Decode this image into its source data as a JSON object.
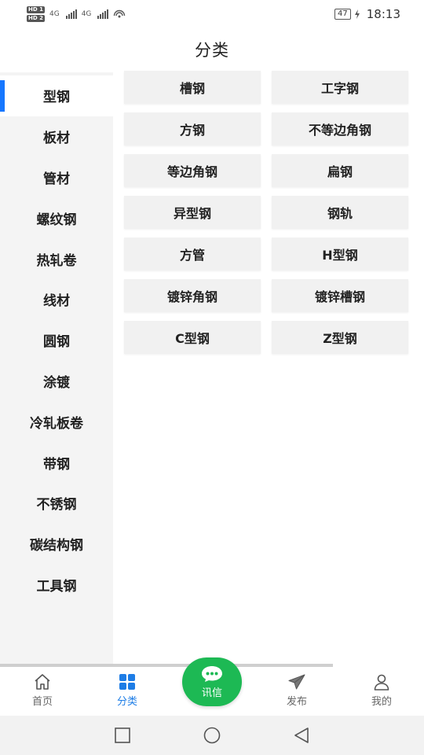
{
  "status": {
    "sim1": "HD 1",
    "sim2": "HD 2",
    "net1": "4G",
    "net2": "4G",
    "battery": "47",
    "time": "18:13"
  },
  "header": {
    "title": "分类"
  },
  "sidebar": {
    "active_index": 0,
    "items": [
      {
        "label": "型钢"
      },
      {
        "label": "板材"
      },
      {
        "label": "管材"
      },
      {
        "label": "螺纹钢"
      },
      {
        "label": "热轧卷"
      },
      {
        "label": "线材"
      },
      {
        "label": "圆钢"
      },
      {
        "label": "涂镀"
      },
      {
        "label": "冷轧板卷"
      },
      {
        "label": "带钢"
      },
      {
        "label": "不锈钢"
      },
      {
        "label": "碳结构钢"
      },
      {
        "label": "工具钢"
      }
    ]
  },
  "subcategories": [
    {
      "label": "槽钢"
    },
    {
      "label": "工字钢"
    },
    {
      "label": "方钢"
    },
    {
      "label": "不等边角钢"
    },
    {
      "label": "等边角钢"
    },
    {
      "label": "扁钢"
    },
    {
      "label": "异型钢"
    },
    {
      "label": "钢轨"
    },
    {
      "label": "方管"
    },
    {
      "label": "H型钢"
    },
    {
      "label": "镀锌角钢"
    },
    {
      "label": "镀锌槽钢"
    },
    {
      "label": "C型钢"
    },
    {
      "label": "Z型钢"
    }
  ],
  "tabbar": {
    "home": {
      "label": "首页",
      "icon": "home-icon"
    },
    "category": {
      "label": "分类",
      "icon": "grid-icon"
    },
    "message": {
      "label": "讯信",
      "icon": "chat-icon"
    },
    "publish": {
      "label": "发布",
      "icon": "send-icon"
    },
    "mine": {
      "label": "我的",
      "icon": "user-icon"
    }
  },
  "colors": {
    "accent": "#1677ff",
    "tab_active": "#1e7de6",
    "fab": "#1db954",
    "sidebar_bg": "#f4f4f4",
    "cell_bg": "#f1f1f1"
  }
}
